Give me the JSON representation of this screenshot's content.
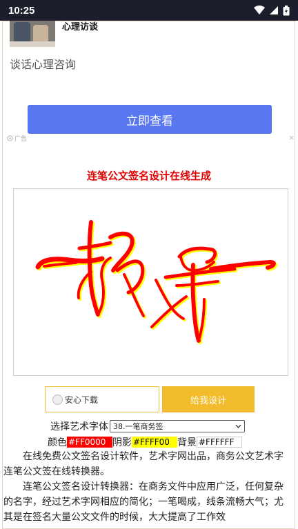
{
  "status_bar": {
    "time": "10:25"
  },
  "ad": {
    "title": "心理访谈",
    "subtitle": "谈话心理咨询",
    "button_label": "立即查看",
    "ad_label": "广告",
    "close_symbol": "×",
    "button_color": "#5877f0"
  },
  "page": {
    "heading": "连笔公文签名设计在线生成",
    "heading_color": "#e00000",
    "signature_text": "杨帆",
    "signature_colors": {
      "fill": "#FF0000",
      "shadow": "#FFFF00",
      "background": "#FFFFFF"
    }
  },
  "actions": {
    "download_label": "安心下载",
    "design_label": "给我设计",
    "design_color": "#f3bc2c"
  },
  "form": {
    "font_label": "选择艺术字体",
    "font_selected": "38.一笔商务签",
    "color_label": "颜色",
    "color_value": "#FF0000",
    "shadow_label": "阴影",
    "shadow_value": "#FFFF00",
    "bg_label": "背景",
    "bg_value": "#FFFFFF"
  },
  "content": {
    "para1": "在线免费公文签名设计软件，艺术字网出品，商务公文艺术字连笔公文签在线转换器。",
    "para2": "连笔公文签名设计转换器：在商务文件中应用广泛，任何复杂的名字，经过艺术字网相应的简化；一笔喝成，线条流畅大气；尤其是在签名大量公文文件的时候，大大提高了工作效"
  }
}
